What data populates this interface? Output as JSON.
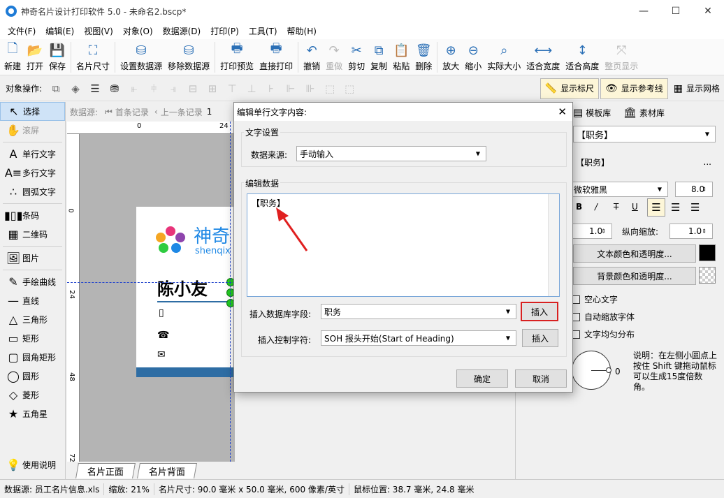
{
  "window": {
    "title": "神奇名片设计打印软件 5.0 - 未命名2.bscp*",
    "minimize": "—",
    "maximize": "☐",
    "close": "✕"
  },
  "menu": [
    "文件(F)",
    "编辑(E)",
    "视图(V)",
    "对象(O)",
    "数据源(D)",
    "打印(P)",
    "工具(T)",
    "帮助(H)"
  ],
  "toolbar": [
    {
      "icon": "new-icon",
      "glyph": "🗋",
      "label": "新建",
      "enabled": true
    },
    {
      "icon": "open-icon",
      "glyph": "📂",
      "label": "打开",
      "enabled": true
    },
    {
      "icon": "save-icon",
      "glyph": "💾",
      "label": "保存",
      "enabled": true
    },
    {
      "sep": true
    },
    {
      "icon": "card-size-icon",
      "glyph": "⛶",
      "label": "名片尺寸",
      "enabled": true
    },
    {
      "sep": true
    },
    {
      "icon": "set-datasource-icon",
      "glyph": "⛁",
      "label": "设置数据源",
      "enabled": true
    },
    {
      "icon": "remove-datasource-icon",
      "glyph": "⛁",
      "label": "移除数据源",
      "enabled": true
    },
    {
      "sep": true
    },
    {
      "icon": "print-preview-icon",
      "glyph": "🖶",
      "label": "打印预览",
      "enabled": true
    },
    {
      "icon": "direct-print-icon",
      "glyph": "🖶",
      "label": "直接打印",
      "enabled": true
    },
    {
      "sep": true
    },
    {
      "icon": "undo-icon",
      "glyph": "↶",
      "label": "撤销",
      "enabled": true
    },
    {
      "icon": "redo-icon",
      "glyph": "↷",
      "label": "重做",
      "enabled": false
    },
    {
      "icon": "cut-icon",
      "glyph": "✂",
      "label": "剪切",
      "enabled": true
    },
    {
      "icon": "copy-icon",
      "glyph": "⧉",
      "label": "复制",
      "enabled": true
    },
    {
      "icon": "paste-icon",
      "glyph": "📋",
      "label": "粘贴",
      "enabled": true
    },
    {
      "icon": "delete-icon",
      "glyph": "🗑",
      "label": "删除",
      "enabled": true
    },
    {
      "sep": true
    },
    {
      "icon": "zoom-in-icon",
      "glyph": "⊕",
      "label": "放大",
      "enabled": true
    },
    {
      "icon": "zoom-out-icon",
      "glyph": "⊖",
      "label": "缩小",
      "enabled": true
    },
    {
      "icon": "actual-size-icon",
      "glyph": "⌕",
      "label": "实际大小",
      "enabled": true
    },
    {
      "icon": "fit-width-icon",
      "glyph": "⟷",
      "label": "适合宽度",
      "enabled": true
    },
    {
      "icon": "fit-height-icon",
      "glyph": "↕",
      "label": "适合高度",
      "enabled": true
    },
    {
      "icon": "whole-page-icon",
      "glyph": "⤧",
      "label": "整页显示",
      "enabled": false
    }
  ],
  "objbar": {
    "label": "对象操作:",
    "toggles": [
      {
        "icon": "ruler-icon",
        "glyph": "📏",
        "label": "显示标尺"
      },
      {
        "icon": "eye-icon",
        "glyph": "👁",
        "label": "显示参考线"
      },
      {
        "icon": "grid-icon",
        "glyph": "▦",
        "label": "显示网格"
      }
    ]
  },
  "tools": [
    {
      "name": "select",
      "glyph": "↖",
      "label": "选择",
      "selected": true,
      "enabled": true
    },
    {
      "name": "pan",
      "glyph": "✋",
      "label": "滚屏",
      "enabled": false
    },
    {
      "sep": true
    },
    {
      "name": "single-line-text",
      "glyph": "A",
      "label": "单行文字",
      "enabled": true
    },
    {
      "name": "multi-line-text",
      "glyph": "A≡",
      "label": "多行文字",
      "enabled": true
    },
    {
      "name": "arc-text",
      "glyph": "∴",
      "label": "圆弧文字",
      "enabled": true
    },
    {
      "sep": true
    },
    {
      "name": "barcode",
      "glyph": "▮▯▮",
      "label": "条码",
      "enabled": true
    },
    {
      "name": "qrcode",
      "glyph": "▦",
      "label": "二维码",
      "enabled": true
    },
    {
      "sep": true
    },
    {
      "name": "image",
      "glyph": "🖼",
      "label": "图片",
      "enabled": true
    },
    {
      "sep": true
    },
    {
      "name": "freehand",
      "glyph": "✎",
      "label": "手绘曲线",
      "enabled": true
    },
    {
      "name": "line",
      "glyph": "—",
      "label": "直线",
      "enabled": true
    },
    {
      "name": "triangle",
      "glyph": "△",
      "label": "三角形",
      "enabled": true
    },
    {
      "name": "rectangle",
      "glyph": "▭",
      "label": "矩形",
      "enabled": true
    },
    {
      "name": "rounded-rect",
      "glyph": "▢",
      "label": "圆角矩形",
      "enabled": true
    },
    {
      "name": "ellipse",
      "glyph": "◯",
      "label": "圆形",
      "enabled": true
    },
    {
      "name": "diamond",
      "glyph": "◇",
      "label": "菱形",
      "enabled": true
    },
    {
      "name": "star",
      "glyph": "★",
      "label": "五角星",
      "enabled": true
    }
  ],
  "help": {
    "label": "使用说明"
  },
  "docbar": {
    "label": "数据源:",
    "first": "首条记录",
    "prev": "上一条记录",
    "page": "1"
  },
  "ruler": {
    "h0": "0",
    "h24": "24",
    "v0": "0",
    "v24": "24",
    "v48": "48",
    "v72": "72"
  },
  "card": {
    "brand_cn": "神奇",
    "brand_en": "shenqix",
    "name": "陈小友"
  },
  "page_tabs": [
    "名片正面",
    "名片背面"
  ],
  "rightpanel": {
    "tabs": [
      "模板库",
      "素材库"
    ],
    "object_select": "【职务】",
    "content": "【职务】",
    "content_btn": "...",
    "font": "微软雅黑",
    "font_size": "8.0",
    "spacing1": "1.0",
    "scale_label": "纵向缩放:",
    "scale_value": "1.0",
    "text_color_btn": "文本颜色和透明度...",
    "bg_color_btn": "背景颜色和透明度...",
    "hollow": "空心文字",
    "autoscale": "自动缩放字体",
    "even": "文字均匀分布",
    "angle": "0",
    "hint": "说明：在左侧小圆点上按住 Shift 键拖动鼠标可以生成15度倍数角。",
    "style_bold": "B",
    "style_italic": "/",
    "style_strike": "T",
    "style_underline": "U"
  },
  "status": {
    "datasource": "数据源: 员工名片信息.xls",
    "zoom": "缩放: 21%",
    "size": "名片尺寸: 90.0 毫米 x 50.0 毫米, 600 像素/英寸",
    "mouse": "鼠标位置: 38.7 毫米, 24.8 毫米"
  },
  "dialog": {
    "title": "编辑单行文字内容:",
    "group1": "文字设置",
    "source_label": "数据来源:",
    "source_value": "手动输入",
    "group2": "编辑数据",
    "edit_value": "【职务】",
    "field_label": "插入数据库字段:",
    "field_value": "职务",
    "insert_btn": "插入",
    "ctrl_label": "插入控制字符:",
    "ctrl_value": "SOH  报头开始(Start of Heading)",
    "insert_btn2": "插入",
    "ok": "确定",
    "cancel": "取消"
  }
}
